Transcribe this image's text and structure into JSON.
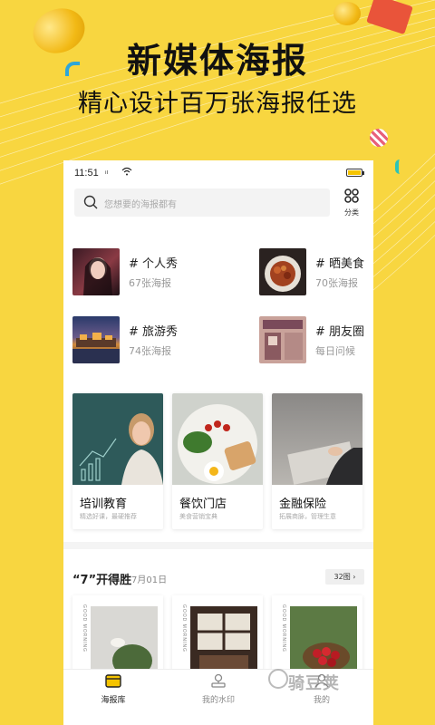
{
  "promo": {
    "title": "新媒体海报",
    "subtitle": "精心设计百万张海报任选"
  },
  "statusbar": {
    "time": "11:51",
    "signal": "ᵢₗ"
  },
  "search": {
    "placeholder": "您想要的海报都有",
    "category_label": "分类"
  },
  "tags": [
    {
      "name": "# 个人秀",
      "count": "67张海报"
    },
    {
      "name": "# 晒美食",
      "count": "70张海报"
    },
    {
      "name": "# 旅游秀",
      "count": "74张海报"
    },
    {
      "name": "# 朋友圈",
      "count": "每日问候"
    }
  ],
  "cards": [
    {
      "title": "培训教育",
      "desc": "精选好课，最硬推荐"
    },
    {
      "title": "餐饮门店",
      "desc": "美食营销宝典"
    },
    {
      "title": "金融保险",
      "desc": "拓展商脉，管理生意"
    }
  ],
  "section": {
    "title": "“7”开得胜",
    "date": "7月01日",
    "more": "32图 ›"
  },
  "poster_text": "GOOD MORNING",
  "tabs": [
    {
      "label": "海报库",
      "active": true
    },
    {
      "label": "我的水印",
      "active": false
    },
    {
      "label": "我的",
      "active": false
    }
  ],
  "watermark": "骑豆荚",
  "colors": {
    "brand_yellow": "#f8d640",
    "accent": "#f5c400"
  }
}
